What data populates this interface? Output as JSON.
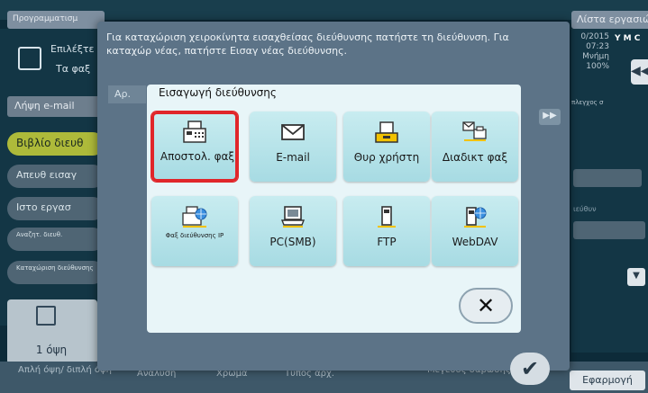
{
  "topbar": {
    "tab_program": "Προγραμματισμ",
    "tab_jobs": "Λίστα εργασιών"
  },
  "left": {
    "select_label": "Επιλέξτε",
    "fax_label": "Τα φαξ",
    "email_recv": "Λήψη e-mail",
    "book": "Βιβλίο διευθ",
    "direct": "Απευθ εισαγ",
    "history": "Ιστο εργασ",
    "search": "Αναζητ. διευθ.",
    "register": "Καταχώριση διεύθυνσης",
    "view": "1 όψη"
  },
  "bottom": {
    "simplex": "Απλή όψη/ διπλή όψη",
    "resolution": "Ανάλυση",
    "color": "Χρώμα",
    "file_type": "Τύπος αρχ.",
    "scan_size": "Μέγεθος σάρωσης",
    "apply": "Εφαρμογή",
    "ok": "✔"
  },
  "right": {
    "date": "0/2015 07:23 Μνήμη 100%",
    "ym": "Y M C",
    "back": "◀◀",
    "control": "πλεγχος σ",
    "addr": "ιεύθυν",
    "down": "▼"
  },
  "info": {
    "text": "Για καταχώριση χειροκίνητα εισαχθείσας διεύθυνσης πατήστε τη διεύθυνση. Για καταχώρ νέας, πατήστε Εισαγ νέας διεύθυνσης.",
    "ar": "Αρ.",
    "arrow": "▶▶"
  },
  "dialog": {
    "title": "Εισαγωγή διεύθυνσης",
    "tiles": [
      {
        "label": "Αποστολ. φαξ",
        "icon": "fax-icon"
      },
      {
        "label": "E-mail",
        "icon": "envelope-icon"
      },
      {
        "label": "Θυρ χρήστη",
        "icon": "user-box-icon"
      },
      {
        "label": "Διαδικτ φαξ",
        "icon": "internet-fax-icon"
      },
      {
        "label": "Φαξ διεύθυνσης IP",
        "icon": "ip-fax-icon"
      },
      {
        "label": "PC(SMB)",
        "icon": "pc-icon"
      },
      {
        "label": "FTP",
        "icon": "ftp-server-icon"
      },
      {
        "label": "WebDAV",
        "icon": "webdav-server-icon"
      }
    ],
    "close": "✕"
  },
  "colors": {
    "accent": "#aeba3a",
    "tile": "#b5e3ea",
    "selected": "#e0262a"
  }
}
